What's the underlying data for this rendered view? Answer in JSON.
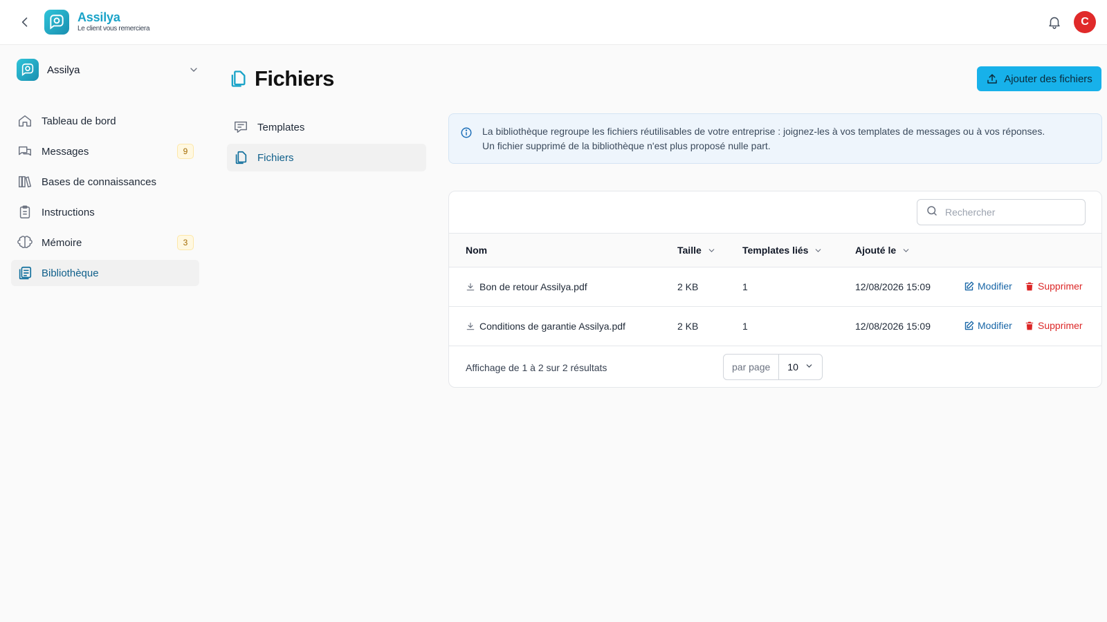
{
  "brand": {
    "name": "Assilya",
    "tagline": "Le client vous remerciera",
    "avatar_initial": "C",
    "accent": "#17b1ea"
  },
  "workspace": {
    "name": "Assilya"
  },
  "sidebar": {
    "items": [
      {
        "label": "Tableau de bord",
        "icon": "home-icon"
      },
      {
        "label": "Messages",
        "icon": "chat-icon",
        "badge": "9"
      },
      {
        "label": "Bases de connaissances",
        "icon": "books-icon"
      },
      {
        "label": "Instructions",
        "icon": "clipboard-icon"
      },
      {
        "label": "Mémoire",
        "icon": "brain-icon",
        "badge": "3"
      },
      {
        "label": "Bibliothèque",
        "icon": "library-icon",
        "active": true
      }
    ]
  },
  "page": {
    "title": "Fichiers",
    "add_button": "Ajouter des fichiers"
  },
  "subnav": {
    "items": [
      {
        "label": "Templates",
        "icon": "template-icon"
      },
      {
        "label": "Fichiers",
        "icon": "files-icon",
        "active": true
      }
    ]
  },
  "info": {
    "line1": "La bibliothèque regroupe les fichiers réutilisables de votre entreprise : joignez-les à vos templates de messages ou à vos réponses.",
    "line2": "Un fichier supprimé de la bibliothèque n'est plus proposé nulle part."
  },
  "search": {
    "placeholder": "Rechercher"
  },
  "table": {
    "columns": {
      "name": "Nom",
      "size": "Taille",
      "templates": "Templates liés",
      "added": "Ajouté le"
    },
    "rows": [
      {
        "name": "Bon de retour Assilya.pdf",
        "size": "2 KB",
        "templates": "1",
        "added": "12/08/2026 15:09",
        "edit": "Modifier",
        "delete": "Supprimer"
      },
      {
        "name": "Conditions de garantie Assilya.pdf",
        "size": "2 KB",
        "templates": "1",
        "added": "12/08/2026 15:09",
        "edit": "Modifier",
        "delete": "Supprimer"
      }
    ],
    "footer": "Affichage de 1 à 2 sur 2 résultats",
    "per_page_label": "par page",
    "per_page_value": "10"
  }
}
